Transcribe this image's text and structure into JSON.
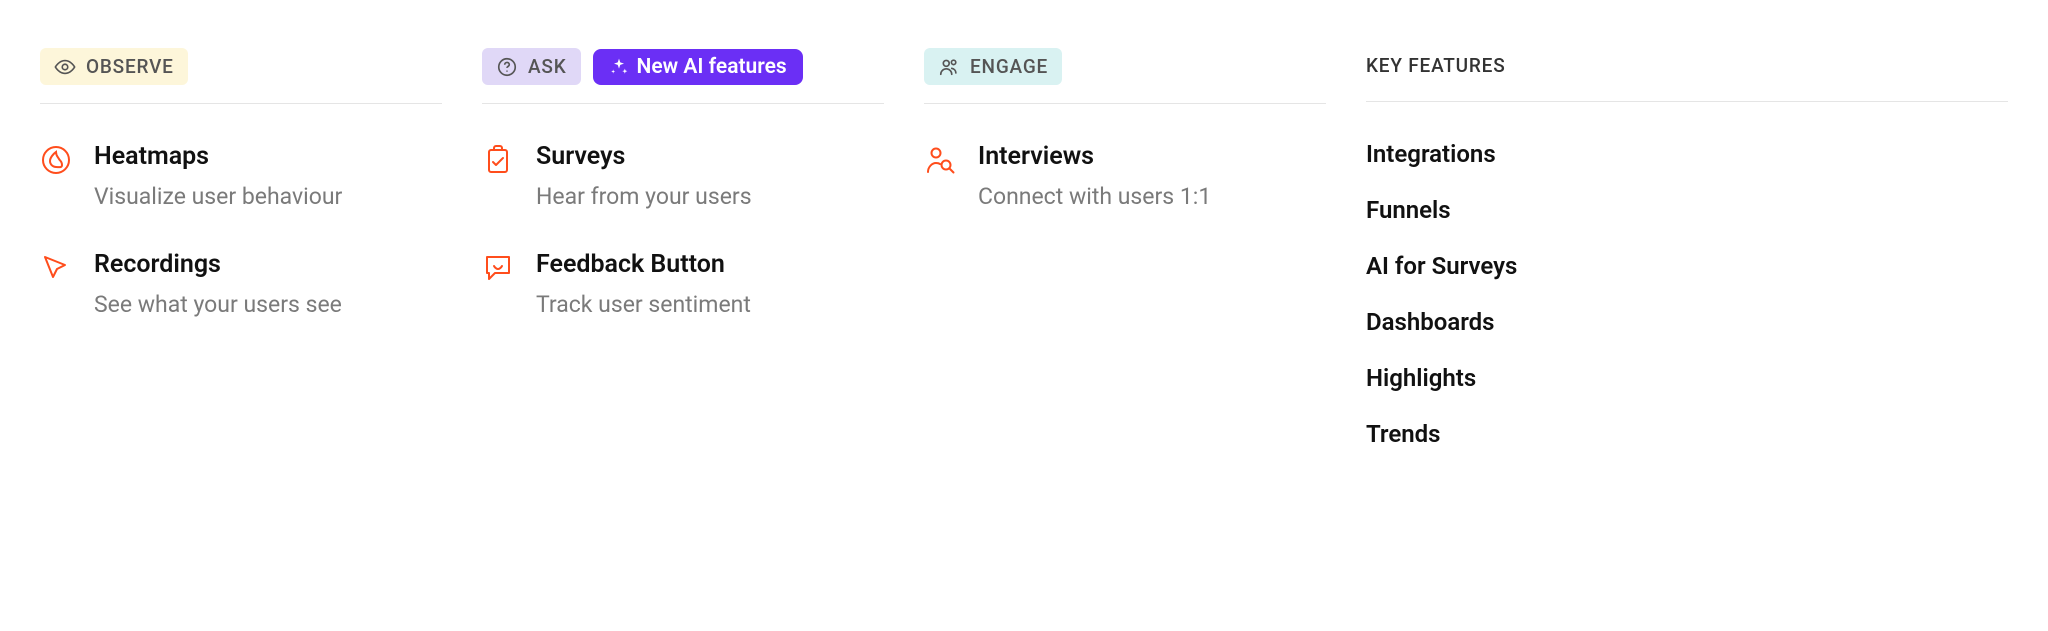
{
  "columns": {
    "observe": {
      "label": "OBSERVE",
      "items": [
        {
          "title": "Heatmaps",
          "desc": "Visualize user behaviour"
        },
        {
          "title": "Recordings",
          "desc": "See what your users see"
        }
      ]
    },
    "ask": {
      "label": "ASK",
      "ai_badge": "New AI features",
      "items": [
        {
          "title": "Surveys",
          "desc": "Hear from your users"
        },
        {
          "title": "Feedback Button",
          "desc": "Track user sentiment"
        }
      ]
    },
    "engage": {
      "label": "ENGAGE",
      "items": [
        {
          "title": "Interviews",
          "desc": "Connect with users 1:1"
        }
      ]
    },
    "key_features": {
      "label": "KEY FEATURES",
      "items": [
        "Integrations",
        "Funnels",
        "AI for Surveys",
        "Dashboards",
        "Highlights",
        "Trends"
      ]
    }
  }
}
